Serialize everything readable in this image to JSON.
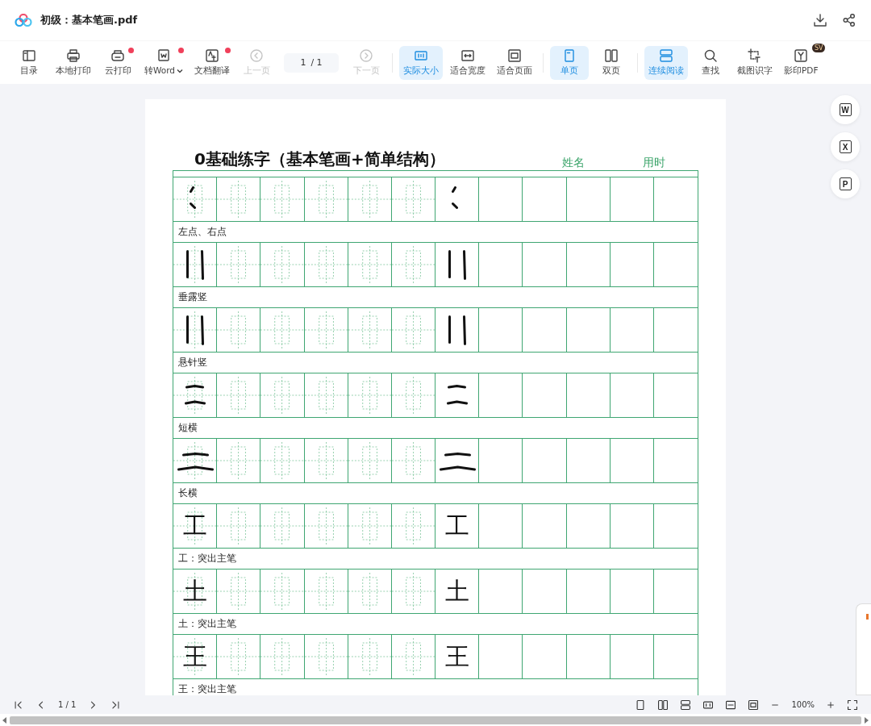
{
  "window": {
    "title": "初级：基本笔画.pdf"
  },
  "toolbar": {
    "groups": [
      [
        {
          "kind": "button",
          "label": "目录",
          "selected": false,
          "disabled": false,
          "badge": false,
          "dropdown": false
        },
        {
          "kind": "button",
          "label": "本地打印",
          "selected": false,
          "disabled": false,
          "badge": false,
          "dropdown": false
        },
        {
          "kind": "button",
          "label": "云打印",
          "selected": false,
          "disabled": false,
          "badge": true,
          "dropdown": false
        },
        {
          "kind": "button",
          "label": "转Word",
          "selected": false,
          "disabled": false,
          "badge": true,
          "dropdown": true
        },
        {
          "kind": "button",
          "label": "文档翻译",
          "selected": false,
          "disabled": false,
          "badge": true,
          "dropdown": false
        },
        {
          "kind": "button",
          "label": "上一页",
          "selected": false,
          "disabled": true,
          "badge": false,
          "dropdown": false
        },
        {
          "kind": "page_field",
          "value": "1",
          "total": "/ 1"
        },
        {
          "kind": "button",
          "label": "下一页",
          "selected": false,
          "disabled": true,
          "badge": false,
          "dropdown": false
        }
      ],
      [
        {
          "kind": "button",
          "label": "实际大小",
          "selected": true,
          "disabled": false,
          "badge": false,
          "dropdown": false
        },
        {
          "kind": "button",
          "label": "适合宽度",
          "selected": false,
          "disabled": false,
          "badge": false,
          "dropdown": false
        },
        {
          "kind": "button",
          "label": "适合页面",
          "selected": false,
          "disabled": false,
          "badge": false,
          "dropdown": false
        }
      ],
      [
        {
          "kind": "button",
          "label": "单页",
          "selected": true,
          "disabled": false,
          "badge": false,
          "dropdown": false
        },
        {
          "kind": "button",
          "label": "双页",
          "selected": false,
          "disabled": false,
          "badge": false,
          "dropdown": false
        }
      ],
      [
        {
          "kind": "button",
          "label": "连续阅读",
          "selected": true,
          "disabled": false,
          "badge": false,
          "dropdown": false
        },
        {
          "kind": "button",
          "label": "查找",
          "selected": false,
          "disabled": false,
          "badge": false,
          "dropdown": false
        },
        {
          "kind": "button",
          "label": "截图识字",
          "selected": false,
          "disabled": false,
          "badge": false,
          "dropdown": false
        },
        {
          "kind": "button",
          "label": "影印PDF",
          "selected": false,
          "disabled": false,
          "badge": false,
          "dropdown": false,
          "tag": "SV"
        }
      ]
    ]
  },
  "sheet": {
    "title": "0基础练字（基本笔画+简单结构）",
    "fields": [
      "姓名",
      "用时"
    ],
    "rows": [
      {
        "kind": "dots",
        "caption": "左点、右点"
      },
      {
        "kind": "verticals",
        "caption": "垂露竖"
      },
      {
        "kind": "verticals",
        "caption": "悬针竖"
      },
      {
        "kind": "short_horizontals",
        "caption": "短横"
      },
      {
        "kind": "long_horizontals",
        "caption": "长横"
      },
      {
        "kind": "glyph",
        "glyphs": [
          "工",
          "工"
        ],
        "caption": "工：突出主笔"
      },
      {
        "kind": "glyph",
        "glyphs": [
          "土",
          "土"
        ],
        "caption": "土：突出主笔"
      },
      {
        "kind": "glyph",
        "glyphs": [
          "王",
          "王"
        ],
        "caption": "王：突出主笔"
      }
    ]
  },
  "side_tools": [
    {
      "letter": "W"
    },
    {
      "letter": "X"
    },
    {
      "letter": "P"
    }
  ],
  "bottom_bar": {
    "page": "1",
    "total": "/ 1",
    "zoom": "100%"
  }
}
